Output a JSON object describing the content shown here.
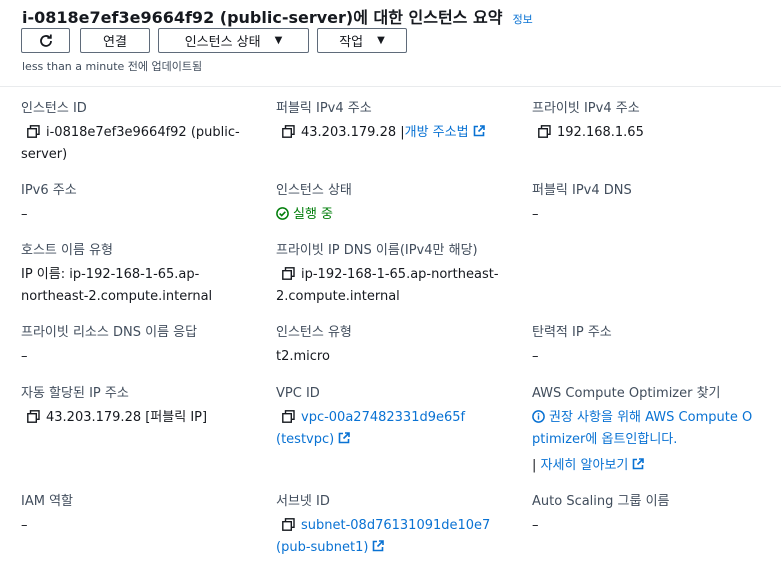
{
  "header": {
    "title": "i-0818e7ef3e9664f92 (public-server)에 대한 인스턴스 요약",
    "info_link": "정보",
    "buttons": {
      "refresh_icon": "refresh-icon",
      "connect": "연결",
      "instance_state": "인스턴스 상태",
      "actions": "작업"
    },
    "updated": "less than a minute 전에 업데이트됨"
  },
  "fields": {
    "instance_id": {
      "label": "인스턴스 ID",
      "value_line1": "i-0818e7ef3e9664f92 (public-",
      "value_line2": "server)"
    },
    "public_ipv4": {
      "label": "퍼블릭 IPv4 주소",
      "value": "43.203.179.28 |",
      "link": "개방 주소법"
    },
    "private_ipv4": {
      "label": "프라이빗 IPv4 주소",
      "value": "192.168.1.65"
    },
    "ipv6": {
      "label": "IPv6 주소",
      "value": "–"
    },
    "instance_state": {
      "label": "인스턴스 상태",
      "value": "실행 중",
      "color": "#037f0c"
    },
    "public_ipv4_dns": {
      "label": "퍼블릭 IPv4 DNS",
      "value": "–"
    },
    "hostname_type": {
      "label": "호스트 이름 유형",
      "value_line1": "IP 이름: ip-192-168-1-65.ap-",
      "value_line2": "northeast-2.compute.internal"
    },
    "private_ip_dns": {
      "label": "프라이빗 IP DNS 이름(IPv4만 해당)",
      "value_line1": "ip-192-168-1-65.ap-northeast-",
      "value_line2": "2.compute.internal"
    },
    "private_resource_dns": {
      "label": "프라이빗 리소스 DNS 이름 응답",
      "value": "–"
    },
    "instance_type": {
      "label": "인스턴스 유형",
      "value": "t2.micro"
    },
    "elastic_ip": {
      "label": "탄력적 IP 주소",
      "value": "–"
    },
    "auto_ip": {
      "label": "자동 할당된 IP 주소",
      "value": "43.203.179.28 [퍼블릭 IP]"
    },
    "vpc_id": {
      "label": "VPC ID",
      "link_line1": "vpc-00a27482331d9e65f",
      "link_line2": "(testvpc)"
    },
    "compute_optimizer": {
      "label": "AWS Compute Optimizer 찾기",
      "link_line1": "권장 사항을 위해 AWS Compute O",
      "link_line2": "ptimizer에 옵트인합니다.",
      "more_prefix": "| ",
      "more_link": "자세히 알아보기"
    },
    "iam_role": {
      "label": "IAM 역할",
      "value": "–"
    },
    "subnet_id": {
      "label": "서브넷 ID",
      "link_line1": "subnet-08d76131091de10e7",
      "link_line2": "(pub-subnet1)"
    },
    "asg_name": {
      "label": "Auto Scaling 그룹 이름",
      "value": "–"
    }
  },
  "colors": {
    "link": "#0972d3",
    "success": "#037f0c",
    "text": "#16191f",
    "label": "#414d5c"
  }
}
